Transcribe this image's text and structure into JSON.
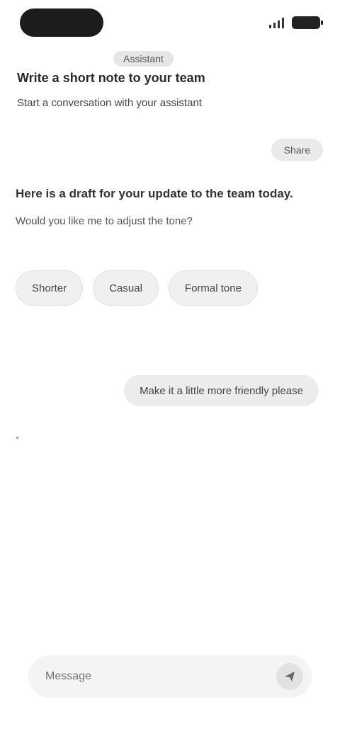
{
  "header": {
    "subtitle": "Assistant",
    "title": "Write a short note to your team",
    "description": "Start a conversation with your assistant"
  },
  "top_chip": "Share",
  "message": {
    "text": "Here is a draft for your update to the team today.",
    "sub": "Would you like me to adjust the tone?"
  },
  "chips": [
    "Shorter",
    "Casual",
    "Formal tone"
  ],
  "user_bubble": "Make it a little more friendly please",
  "small_mark": "•",
  "input": {
    "placeholder": "Message",
    "send_icon": "send-icon"
  },
  "colors": {
    "background": "#ffffff",
    "pill": "#1c1c1c",
    "chip_bg": "#f0f0f0",
    "input_bg": "#f4f4f4"
  }
}
